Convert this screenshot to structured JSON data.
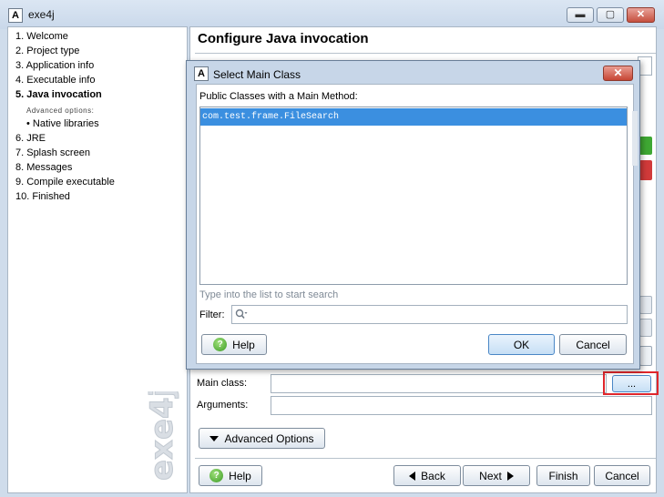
{
  "window": {
    "title": "exe4j",
    "logo_glyph": "A",
    "min_label": "▬",
    "max_label": "▢",
    "close_label": "✕"
  },
  "sidebar": {
    "steps": [
      {
        "label": "1. Welcome"
      },
      {
        "label": "2. Project type"
      },
      {
        "label": "3. Application info"
      },
      {
        "label": "4. Executable info"
      },
      {
        "label": "5. Java invocation"
      },
      {
        "label": "Advanced options:"
      },
      {
        "label": "•  Native libraries"
      },
      {
        "label": "6. JRE"
      },
      {
        "label": "7. Splash screen"
      },
      {
        "label": "8. Messages"
      },
      {
        "label": "9. Compile executable"
      },
      {
        "label": "10. Finished"
      }
    ],
    "active_step": "5. Java invocation",
    "watermark": "exe4j"
  },
  "page": {
    "title": "Configure Java invocation",
    "main_class_label": "Main class:",
    "main_class_value": "",
    "browse_label": "...",
    "arguments_label": "Arguments:",
    "arguments_value": "",
    "advanced_options_label": "Advanced Options"
  },
  "footer": {
    "help_label": "Help",
    "back_label": "Back",
    "next_label": "Next",
    "finish_label": "Finish",
    "cancel_label": "Cancel"
  },
  "dialog": {
    "title": "Select Main Class",
    "logo_glyph": "A",
    "close_label": "✕",
    "list_label": "Public Classes with a Main Method:",
    "classes": [
      "com.test.frame.FileSearch"
    ],
    "selected_index": 0,
    "search_hint": "Type into the list to start search",
    "filter_label": "Filter:",
    "filter_value": "",
    "help_label": "Help",
    "ok_label": "OK",
    "cancel_label": "Cancel"
  },
  "colors": {
    "selection": "#3b8fe0",
    "highlight_box": "#e0262b",
    "window_frame": "#cfdceb"
  }
}
